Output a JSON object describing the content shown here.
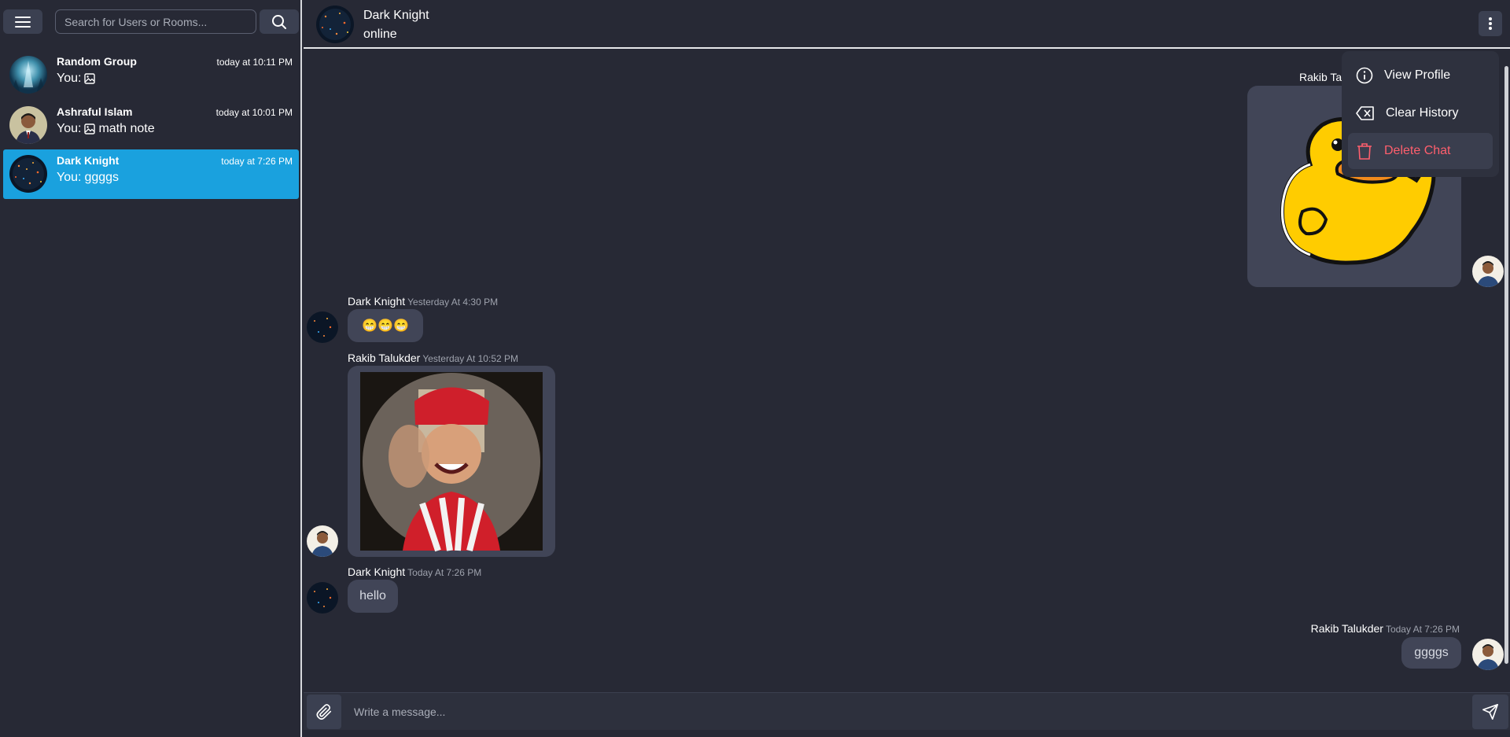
{
  "sidebar": {
    "search": {
      "placeholder": "Search for Users or Rooms..."
    },
    "chats": [
      {
        "name": "Random Group",
        "time": "today at 10:11 PM",
        "preview_prefix": "You:",
        "preview_text": "",
        "has_image_icon": true
      },
      {
        "name": "Ashraful Islam",
        "time": "today at 10:01 PM",
        "preview_prefix": "You:",
        "preview_text": "math note",
        "has_image_icon": true
      },
      {
        "name": "Dark Knight",
        "time": "today at 7:26 PM",
        "preview_prefix": "You:",
        "preview_text": "ggggs",
        "has_image_icon": false,
        "active": true
      }
    ]
  },
  "header": {
    "title": "Dark Knight",
    "status": "online"
  },
  "messages": [
    {
      "sender": "Rakib Talukder",
      "sender_visible": "Rakib Ta",
      "kind": "sticker",
      "side": "right"
    },
    {
      "sender": "Dark Knight",
      "time": "Yesterday At 4:30 PM",
      "kind": "text",
      "text": "😁😁😁",
      "side": "left"
    },
    {
      "sender": "Rakib Talukder",
      "time": "Yesterday At 10:52 PM",
      "kind": "image",
      "side": "left"
    },
    {
      "sender": "Dark Knight",
      "time": "Today At 7:26 PM",
      "kind": "text",
      "text": "hello",
      "side": "left"
    },
    {
      "sender": "Rakib Talukder",
      "time": "Today At 7:26 PM",
      "kind": "text",
      "text": "ggggs",
      "side": "right"
    }
  ],
  "composer": {
    "placeholder": "Write a message..."
  },
  "menu": {
    "view_profile": "View Profile",
    "clear_history": "Clear History",
    "delete_chat": "Delete Chat"
  },
  "colors": {
    "background": "#272935",
    "active_chat": "#1aa1de",
    "bubble": "#414557",
    "danger": "#ff5f6d"
  }
}
